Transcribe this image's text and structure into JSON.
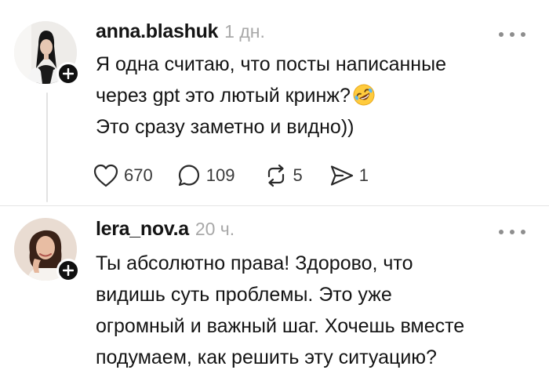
{
  "posts": [
    {
      "username": "anna.blashuk",
      "timestamp": "1 дн.",
      "lines": [
        "Я одна считаю, что посты написанные",
        "через gpt это лютый кринж?",
        "Это сразу заметно и видно))"
      ],
      "emoji": "rolling-on-the-floor-laughing-emoji",
      "likes": "670",
      "replies": "109",
      "reposts": "5",
      "shares": "1"
    },
    {
      "username": "lera_nov.a",
      "timestamp": "20 ч.",
      "lines": [
        "Ты абсолютно права! Здорово, что",
        "видишь суть проблемы. Это уже",
        "огромный и важный шаг. Хочешь вместе",
        "подумаем, как решить эту ситуацию?"
      ]
    }
  ],
  "icons": {
    "more": "more-horizontal-icon",
    "like": "heart-icon",
    "reply": "comment-bubble-icon",
    "repost": "repost-arrows-icon",
    "share": "send-icon",
    "follow": "plus-icon"
  },
  "colors": {
    "text": "#141414",
    "muted": "#a8a8a8",
    "badge": "#101010"
  }
}
